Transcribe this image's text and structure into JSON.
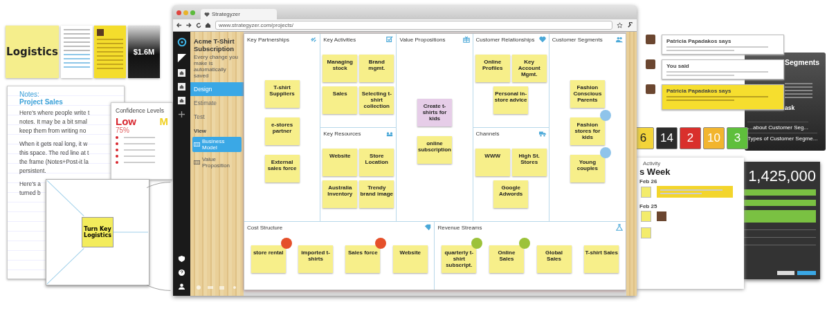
{
  "browser": {
    "tab_title": "Strategyzer",
    "url": "www.strategyzer.com/projects/"
  },
  "sidebar": {
    "project_title": "Acme T-Shirt Subscription",
    "subtitle": "Every change you make is automatically saved",
    "nav": [
      {
        "label": "Design",
        "selected": true
      },
      {
        "label": "Estimate",
        "selected": false
      },
      {
        "label": "Test",
        "selected": false
      }
    ],
    "view_label": "View",
    "views": [
      {
        "label": "Business Model",
        "selected": true
      },
      {
        "label": "Value Proposition",
        "selected": false
      }
    ]
  },
  "canvas": {
    "blocks": [
      {
        "title": "Key Partnerships",
        "notes": [
          {
            "text": "T-shirt Suppliers",
            "color": "#f7ef8a"
          },
          {
            "text": "e-stores partner",
            "color": "#f7ef8a"
          },
          {
            "text": "External sales force",
            "color": "#f7ef8a"
          }
        ]
      },
      {
        "title": "Key Activities",
        "notes": [
          {
            "text": "Managing stock",
            "color": "#f7ef8a"
          },
          {
            "text": "Brand mgmt.",
            "color": "#f7ef8a"
          },
          {
            "text": "Sales",
            "color": "#f7ef8a"
          },
          {
            "text": "Selecting t-shirt collection",
            "color": "#f7ef8a"
          }
        ]
      },
      {
        "title": "Key Resources",
        "notes": [
          {
            "text": "Website",
            "color": "#f7ef8a"
          },
          {
            "text": "Store Location",
            "color": "#f7ef8a"
          },
          {
            "text": "Australia Inventory",
            "color": "#f7ef8a"
          },
          {
            "text": "Trendy brand image",
            "color": "#f7ef8a"
          }
        ]
      },
      {
        "title": "Value Propositions",
        "notes": [
          {
            "text": "Create t-shirts for kids",
            "color": "#e6cde8"
          },
          {
            "text": "online subscription",
            "color": "#f7ef8a"
          }
        ]
      },
      {
        "title": "Customer Relationships",
        "notes": [
          {
            "text": "Online Profiles",
            "color": "#f7ef8a"
          },
          {
            "text": "Key Account Mgmt.",
            "color": "#f7ef8a"
          },
          {
            "text": "Personal in-store advice",
            "color": "#f7ef8a"
          }
        ]
      },
      {
        "title": "Channels",
        "notes": [
          {
            "text": "WWW",
            "color": "#f7ef8a"
          },
          {
            "text": "High St. Stores",
            "color": "#f7ef8a"
          },
          {
            "text": "Google Adwords",
            "color": "#f7ef8a"
          }
        ]
      },
      {
        "title": "Customer Segments",
        "notes": [
          {
            "text": "Fashion Conscious Parents",
            "color": "#f7ef8a"
          },
          {
            "text": "Fashion stores for kids",
            "color": "#f7ef8a",
            "badge": {
              "color": "#8fc4ea"
            }
          },
          {
            "text": "Young couples",
            "color": "#f7ef8a",
            "badge": {
              "color": "#8fc4ea"
            }
          }
        ]
      },
      {
        "title": "Cost Structure",
        "notes": [
          {
            "text": "store rental",
            "color": "#f7ef8a",
            "badge": {
              "color": "#e5502a"
            }
          },
          {
            "text": "imported t-shirts",
            "color": "#f7ef8a"
          },
          {
            "text": "Sales force",
            "color": "#f7ef8a",
            "badge": {
              "color": "#e5502a"
            }
          },
          {
            "text": "Website",
            "color": "#f7ef8a"
          }
        ]
      },
      {
        "title": "Revenue Streams",
        "notes": [
          {
            "text": "quarterly t-shirt subscript.",
            "color": "#f7ef8a",
            "badge": {
              "color": "#9cc23a"
            }
          },
          {
            "text": "Online Sales",
            "color": "#f7ef8a",
            "badge": {
              "color": "#9cc23a"
            }
          },
          {
            "text": "Global Sales",
            "color": "#f7ef8a"
          },
          {
            "text": "T-shirt Sales",
            "color": "#f7ef8a"
          }
        ]
      }
    ]
  },
  "left_collage": {
    "logistics_note": "Logistics",
    "revenue_card": "$1.6M",
    "notes_panel": {
      "label": "Notes:",
      "title": "Project Sales",
      "lines": [
        "Here's where people write t",
        "notes. It may be a bit smal",
        "keep them from writing no",
        "When it gets real long, it w",
        "this space. The red line at t",
        "the frame (Notes+Post-it la",
        "persistent.",
        "Here's a",
        "turned b"
      ]
    },
    "confidence": {
      "title": "Confidence Levels",
      "level": "Low",
      "percent": "75%",
      "next_level": "M"
    },
    "diagram": {
      "note": "Turn Key Logistics"
    }
  },
  "right_collage": {
    "comments": [
      {
        "author": "Patricia Papadakos says",
        "highlighted": false
      },
      {
        "author": "You said",
        "highlighted": false
      },
      {
        "author": "Patricia Papadakos says",
        "highlighted": true
      }
    ],
    "segments_panel": {
      "title": "Segments",
      "heading": "ask",
      "links": [
        "…about Customer Seg...",
        "Types of Customer Segme..."
      ]
    },
    "tiles": [
      {
        "value": "6",
        "color": "#f3d43a"
      },
      {
        "value": "14",
        "color": "#2b2b2b"
      },
      {
        "value": "2",
        "color": "#d9302c"
      },
      {
        "value": "10",
        "color": "#f2b52e"
      },
      {
        "value": "3",
        "color": "#5fbf3c"
      }
    ],
    "activity": {
      "label": "Activity",
      "title": "s Week",
      "dates": [
        "Feb 26",
        "Feb 25"
      ]
    },
    "total": "1,425,000"
  }
}
